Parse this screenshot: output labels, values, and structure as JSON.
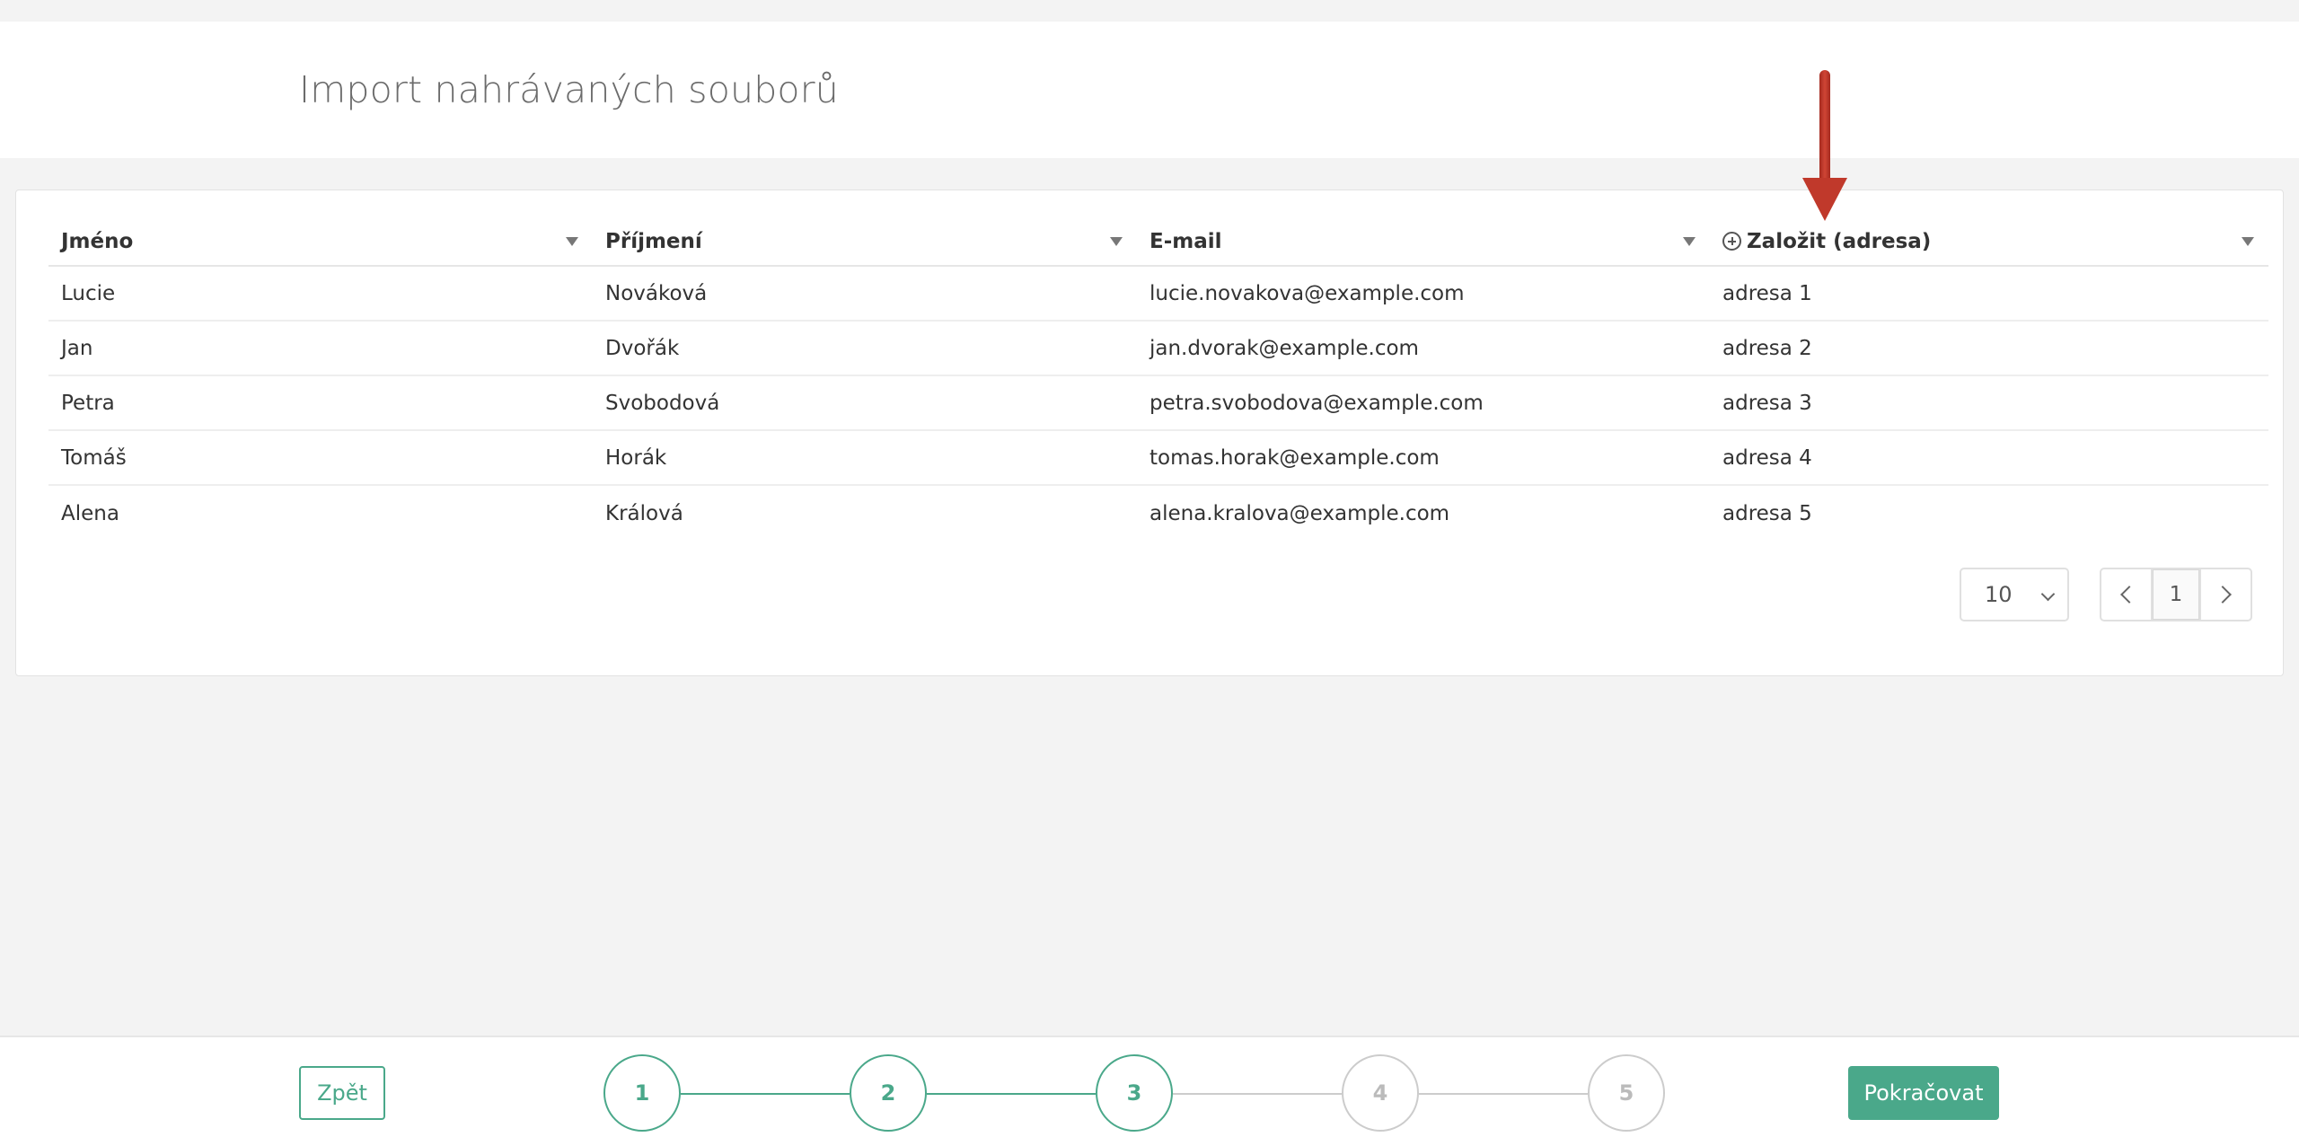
{
  "header": {
    "title": "Import nahrávaných souborů"
  },
  "table": {
    "columns": [
      {
        "label": "Jméno"
      },
      {
        "label": "Příjmení"
      },
      {
        "label": "E-mail"
      },
      {
        "label": "Založit (adresa)",
        "icon": "plus-circle-icon"
      }
    ],
    "rows": [
      [
        "Lucie",
        "Nováková",
        "lucie.novakova@example.com",
        "adresa 1"
      ],
      [
        "Jan",
        "Dvořák",
        "jan.dvorak@example.com",
        "adresa 2"
      ],
      [
        "Petra",
        "Svobodová",
        "petra.svobodova@example.com",
        "adresa 3"
      ],
      [
        "Tomáš",
        "Horák",
        "tomas.horak@example.com",
        "adresa 4"
      ],
      [
        "Alena",
        "Králová",
        "alena.kralova@example.com",
        "adresa 5"
      ]
    ]
  },
  "pagination": {
    "page_size": "10",
    "current_page": "1",
    "prev_icon": "chevron-left-icon",
    "next_icon": "chevron-right-icon"
  },
  "annotation": {
    "icon": "red-arrow-down-icon",
    "color": "#c0392b"
  },
  "footer": {
    "back_label": "Zpět",
    "next_label": "Pokračovat",
    "steps": [
      {
        "label": "1",
        "active": true
      },
      {
        "label": "2",
        "active": true
      },
      {
        "label": "3",
        "active": true
      },
      {
        "label": "4",
        "active": false
      },
      {
        "label": "5",
        "active": false
      }
    ]
  },
  "colors": {
    "accent": "#4aa88a",
    "inactive": "#cccccc",
    "background": "#f3f3f3"
  }
}
